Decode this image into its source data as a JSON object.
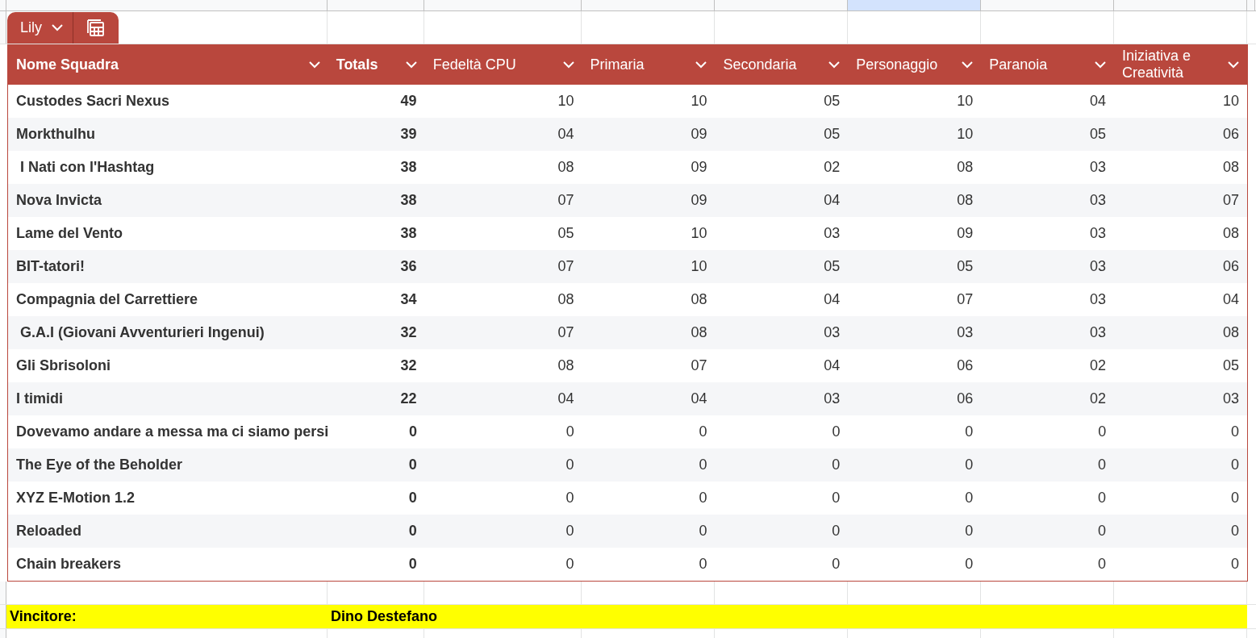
{
  "sheet_columns": [
    {
      "selected": false
    },
    {
      "selected": false
    },
    {
      "selected": false
    },
    {
      "selected": false
    },
    {
      "selected": false
    },
    {
      "selected": true
    },
    {
      "selected": false
    },
    {
      "selected": false
    },
    {
      "selected": false
    }
  ],
  "table_tab": {
    "name": "Lily"
  },
  "table": {
    "columns": [
      {
        "label": "Nome Squadra",
        "bold": true
      },
      {
        "label": "Totals",
        "bold": true
      },
      {
        "label": "Fedeltà CPU",
        "bold": false
      },
      {
        "label": "Primaria",
        "bold": false
      },
      {
        "label": "Secondaria",
        "bold": false
      },
      {
        "label": "Personaggio",
        "bold": false
      },
      {
        "label": "Paranoia",
        "bold": false
      },
      {
        "label": "Iniziativa e Creatività",
        "bold": false
      }
    ],
    "rows": [
      [
        "Custodes Sacri Nexus",
        "49",
        "10",
        "10",
        "05",
        "10",
        "04",
        "10"
      ],
      [
        "Morkthulhu",
        "39",
        "04",
        "09",
        "05",
        "10",
        "05",
        "06"
      ],
      [
        " I Nati con l'Hashtag",
        "38",
        "08",
        "09",
        "02",
        "08",
        "03",
        "08"
      ],
      [
        "Nova Invicta",
        "38",
        "07",
        "09",
        "04",
        "08",
        "03",
        "07"
      ],
      [
        "Lame del Vento",
        "38",
        "05",
        "10",
        "03",
        "09",
        "03",
        "08"
      ],
      [
        "BIT-tatori!",
        "36",
        "07",
        "10",
        "05",
        "05",
        "03",
        "06"
      ],
      [
        "Compagnia del Carrettiere",
        "34",
        "08",
        "08",
        "04",
        "07",
        "03",
        "04"
      ],
      [
        " G.A.I (Giovani Avventurieri Ingenui)",
        "32",
        "07",
        "08",
        "03",
        "03",
        "03",
        "08"
      ],
      [
        "Gli Sbrisoloni",
        "32",
        "08",
        "07",
        "04",
        "06",
        "02",
        "05"
      ],
      [
        "I timidi",
        "22",
        "04",
        "04",
        "03",
        "06",
        "02",
        "03"
      ],
      [
        "Dovevamo andare a messa ma ci siamo persi",
        "0",
        "0",
        "0",
        "0",
        "0",
        "0",
        "0"
      ],
      [
        "The Eye of the Beholder",
        "0",
        "0",
        "0",
        "0",
        "0",
        "0",
        "0"
      ],
      [
        "XYZ E-Motion 1.2",
        "0",
        "0",
        "0",
        "0",
        "0",
        "0",
        "0"
      ],
      [
        "Reloaded",
        "0",
        "0",
        "0",
        "0",
        "0",
        "0",
        "0"
      ],
      [
        "Chain breakers",
        "0",
        "0",
        "0",
        "0",
        "0",
        "0",
        "0"
      ]
    ]
  },
  "winner": {
    "label": "Vincitore:",
    "value": "Dino Destefano"
  }
}
